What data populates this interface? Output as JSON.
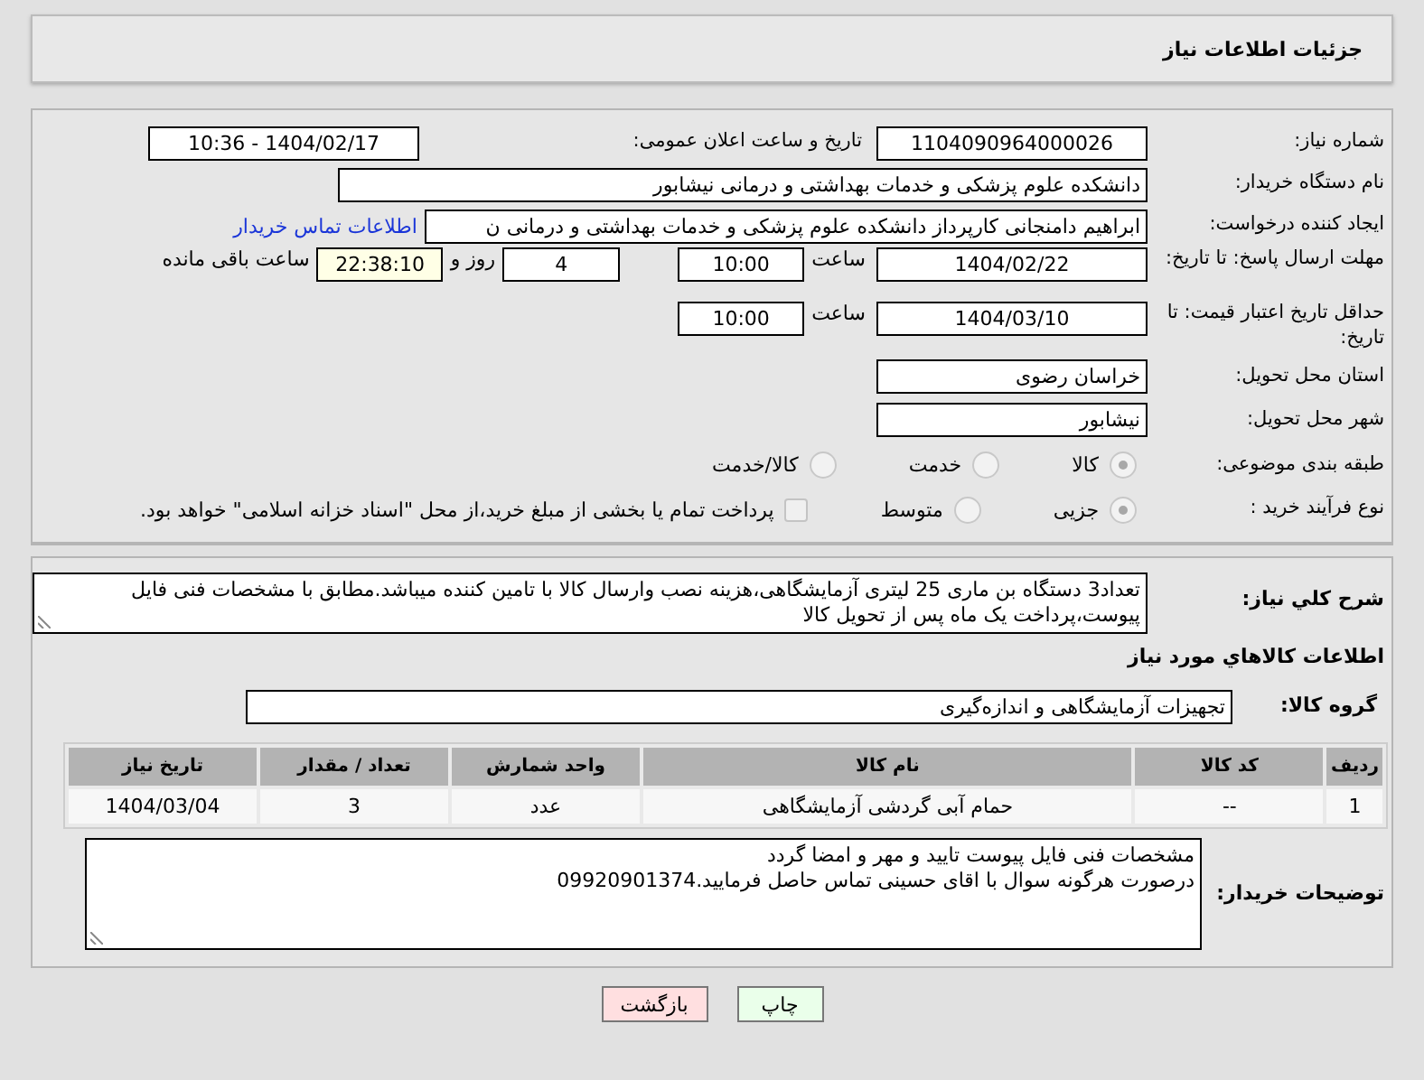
{
  "header": {
    "title": "جزئیات اطلاعات نیاز"
  },
  "need_number": {
    "label": "شماره نیاز:",
    "value": "1104090964000026"
  },
  "announce": {
    "label": "تاریخ و ساعت اعلان عمومی:",
    "value": "1404/02/17 - 10:36"
  },
  "buyer_org": {
    "label": "نام دستگاه خریدار:",
    "value": "دانشکده علوم پزشکی و خدمات بهداشتی و درمانی نیشابور"
  },
  "creator": {
    "label": "ایجاد کننده درخواست:",
    "value": "ابراهیم دامنجانی  کارپرداز دانشکده علوم پزشکی و خدمات بهداشتی و درمانی ن",
    "link": "اطلاعات تماس خریدار"
  },
  "reply_deadline": {
    "label": "مهلت ارسال پاسخ: تا تاریخ:",
    "date": "1404/02/22",
    "time_label": "ساعت",
    "time": "10:00",
    "days": "4",
    "days_label": "روز و",
    "remaining": "22:38:10",
    "remaining_label": "ساعت باقی مانده"
  },
  "price_validity": {
    "label": "حداقل تاریخ اعتبار قیمت: تا تاریخ:",
    "date": "1404/03/10",
    "time_label": "ساعت",
    "time": "10:00"
  },
  "province": {
    "label": "استان محل تحویل:",
    "value": "خراسان رضوی"
  },
  "city": {
    "label": "شهر محل تحویل:",
    "value": "نیشابور"
  },
  "category": {
    "label": "طبقه بندی موضوعی:",
    "options": [
      {
        "label": "کالا",
        "selected": true
      },
      {
        "label": "خدمت",
        "selected": false
      },
      {
        "label": "کالا/خدمت",
        "selected": false
      }
    ]
  },
  "process": {
    "label": "نوع فرآیند خرید :",
    "options": [
      {
        "label": "جزیی",
        "selected": true
      },
      {
        "label": "متوسط",
        "selected": false
      }
    ],
    "payment_note": {
      "label": "پرداخت تمام یا بخشی از مبلغ خرید،از محل \"اسناد خزانه اسلامی\" خواهد بود.",
      "checked": false
    }
  },
  "description": {
    "label": "شرح کلي نياز:",
    "value": "تعداد3 دستگاه بن ماری 25 لیتری آزمایشگاهی،هزینه نصب وارسال کالا با تامین کننده میباشد.مطابق با مشخصات فنی فایل پیوست،پرداخت یک ماه پس از تحویل کالا"
  },
  "goods_section": {
    "title": "اطلاعات کالاهاي مورد نياز"
  },
  "goods_group": {
    "label": "گروه کالا:",
    "value": "تجهیزات آزمایشگاهی و اندازه‌گیری"
  },
  "table": {
    "columns": [
      "ردیف",
      "کد کالا",
      "نام کالا",
      "واحد شمارش",
      "تعداد / مقدار",
      "تاریخ نیاز"
    ],
    "rows": [
      [
        "1",
        "--",
        "حمام آبی گردشی آزمایشگاهی",
        "عدد",
        "3",
        "1404/03/04"
      ]
    ]
  },
  "buyer_notes": {
    "label": "توضیحات خریدار:",
    "lines": [
      "مشخصات فنی فایل پیوست تایید و مهر و امضا گردد",
      "درصورت هرگونه سوال با اقای حسینی تماس حاصل فرمایید.09920901374"
    ]
  },
  "buttons": [
    {
      "label": "چاپ",
      "kind": "print"
    },
    {
      "label": "بازگشت",
      "kind": "back"
    }
  ]
}
